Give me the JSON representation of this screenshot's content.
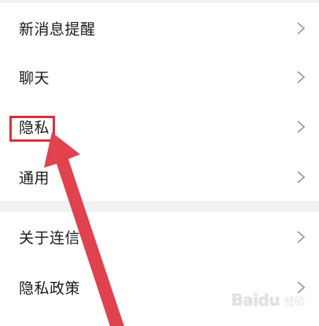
{
  "settings": {
    "items": [
      {
        "label": "新消息提醒"
      },
      {
        "label": "聊天"
      },
      {
        "label": "隐私"
      },
      {
        "label": "通用"
      },
      {
        "label": "关于连信"
      },
      {
        "label": "隐私政策"
      }
    ]
  },
  "watermark": {
    "brand": "Baidu",
    "suffix": "经验"
  },
  "colors": {
    "highlight": "#d9313a",
    "arrow": "#e0424e",
    "text": "#1a1a1a",
    "chevron": "#9e9e9e"
  }
}
